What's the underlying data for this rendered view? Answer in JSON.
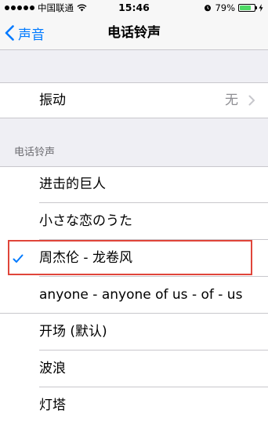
{
  "status_bar": {
    "carrier": "中国联通",
    "time": "15:46",
    "battery_percent": "79%",
    "battery_level": 0.79,
    "icons": [
      "signal-dots-icon",
      "wifi-icon",
      "alarm-icon",
      "battery-icon",
      "charging-icon"
    ]
  },
  "nav": {
    "back_label": "声音",
    "title": "电话铃声"
  },
  "vibration": {
    "label": "振动",
    "value": "无"
  },
  "ringtones": {
    "section_header": "电话铃声",
    "custom": [
      {
        "label": "进击的巨人",
        "selected": false
      },
      {
        "label": "小さな恋のうた",
        "selected": false
      },
      {
        "label": "周杰伦 - 龙卷风",
        "selected": true
      },
      {
        "label": "anyone - anyone of us - of - us",
        "selected": false
      }
    ],
    "system": [
      {
        "label": "开场 (默认)"
      },
      {
        "label": "波浪"
      },
      {
        "label": "灯塔"
      }
    ]
  },
  "colors": {
    "accent": "#007aff",
    "highlight_box": "#e0453a",
    "battery_fill": "#4cd964"
  }
}
